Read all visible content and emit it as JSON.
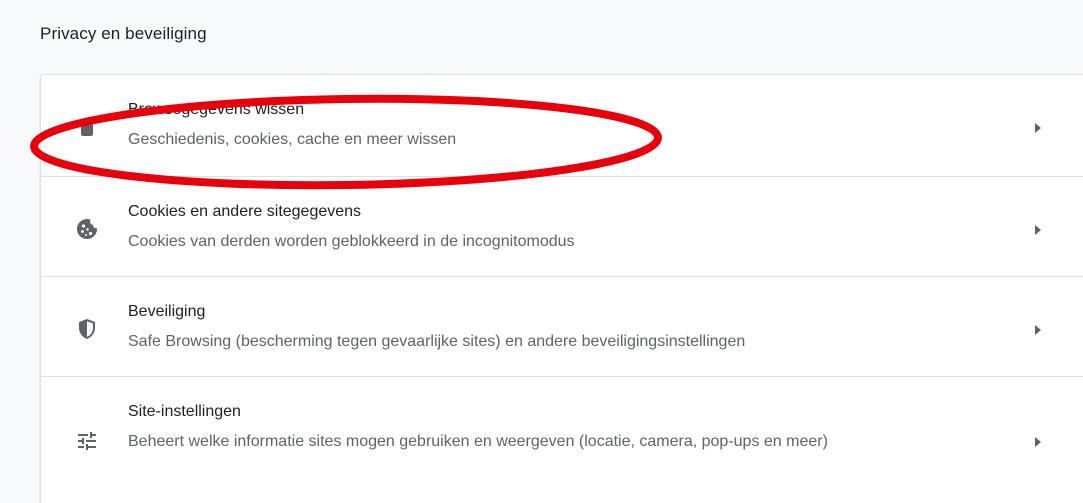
{
  "section": {
    "title": "Privacy en beveiliging"
  },
  "rows": [
    {
      "label": "Browsegegevens wissen",
      "sub": "Geschiedenis, cookies, cache en meer wissen",
      "icon": "trash-icon"
    },
    {
      "label": "Cookies en andere sitegegevens",
      "sub": "Cookies van derden worden geblokkeerd in de incognitomodus",
      "icon": "cookie-icon"
    },
    {
      "label": "Beveiliging",
      "sub": "Safe Browsing (bescherming tegen gevaarlijke sites) en andere beveiligingsinstellingen",
      "icon": "shield-icon"
    },
    {
      "label": "Site-instellingen",
      "sub": "Beheert welke informatie sites mogen gebruiken en weergeven (locatie, camera, pop-ups en meer)",
      "icon": "tune-icon"
    }
  ],
  "colors": {
    "highlight": "#e8000b",
    "icon": "#5f6368",
    "text": "#202124",
    "subtext": "#5f6368",
    "divider": "#e0e0e0"
  }
}
